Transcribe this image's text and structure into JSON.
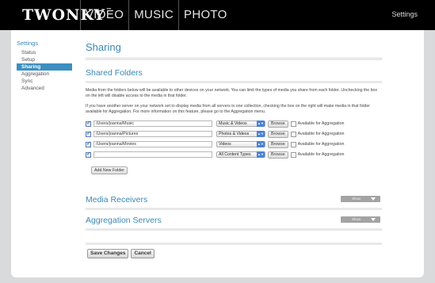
{
  "topbar": {
    "logo": "TWONKY",
    "logo_mark": "™",
    "nav": [
      "VIDEO",
      "MUSIC",
      "PHOTO"
    ],
    "settings": "Settings"
  },
  "sidebar": {
    "title": "Settings",
    "items": [
      {
        "label": "Status",
        "active": false
      },
      {
        "label": "Setup",
        "active": false
      },
      {
        "label": "Sharing",
        "active": true
      },
      {
        "label": "Aggregation",
        "active": false
      },
      {
        "label": "Sync",
        "active": false
      },
      {
        "label": "Advanced",
        "active": false
      }
    ]
  },
  "page": {
    "title": "Sharing",
    "shared_folders": {
      "title": "Shared Folders",
      "para1": "Media from the folders below will be available to other devices on your network. You can limit the types of media you share from each folder. Unchecking the box on the left will disable access to the media in that folder.",
      "para2": "If you have another server on your network set to display media from all servers in one collection, checking the box on the right will make media in that folder available for Aggregation. For more information on this feature, please go to the Aggregation menu.",
      "browse_label": "Browse",
      "aggregation_label": "Available for Aggregation",
      "rows": [
        {
          "checked": true,
          "path": "/Users/joanna/Music",
          "type": "Music & Videos",
          "aggregation": false
        },
        {
          "checked": true,
          "path": "/Users/joanna/Pictures",
          "type": "Photos & Videos",
          "aggregation": false
        },
        {
          "checked": true,
          "path": "/Users/joanna/Movies",
          "type": "Videos",
          "aggregation": false
        },
        {
          "checked": true,
          "path": "",
          "type": "All Content Types",
          "aggregation": false
        }
      ],
      "add_button": "Add New Folder"
    },
    "media_receivers": {
      "title": "Media Receivers",
      "show": "Show"
    },
    "aggregation_servers": {
      "title": "Aggregation Servers",
      "show": "Show"
    },
    "actions": {
      "save": "Save Changes",
      "cancel": "Cancel"
    }
  },
  "colors": {
    "accent": "#3a88b4",
    "active_item": "#3d8fc0",
    "topbar": "#000000"
  }
}
